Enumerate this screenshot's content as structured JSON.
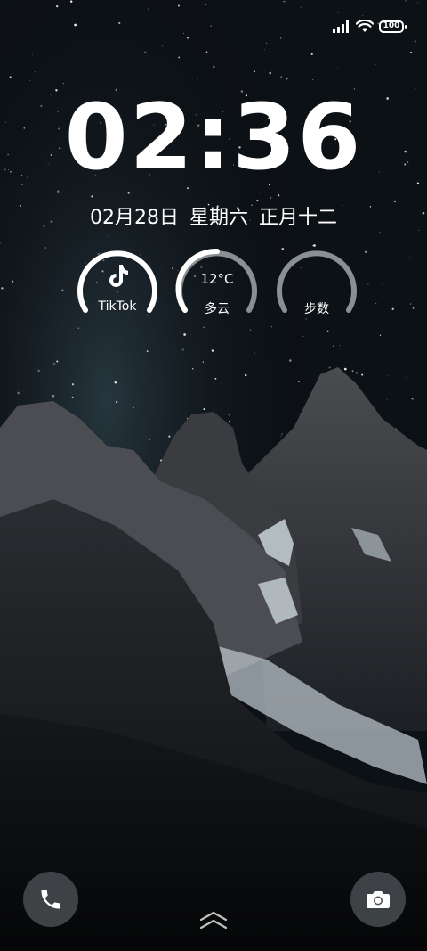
{
  "status_bar": {
    "battery_level": "100",
    "icons": [
      "signal-icon",
      "wifi-icon",
      "battery-icon"
    ]
  },
  "lock_screen": {
    "time": "02:36",
    "date": "02月28日",
    "weekday": "星期六",
    "lunar_date": "正月十二"
  },
  "widgets": {
    "tiktok": {
      "label": "TikTok",
      "icon": "tiktok-icon"
    },
    "weather": {
      "temperature": "12°C",
      "condition": "多云"
    },
    "steps": {
      "label": "步数"
    }
  },
  "shortcuts": {
    "phone_icon": "phone-icon",
    "camera_icon": "camera-icon",
    "swipe_icon": "swipe-up-icon"
  },
  "colors": {
    "text": "#ffffff",
    "ring_active": "#ffffff",
    "ring_inactive": "#8a8f94",
    "button_bg": "#50555a"
  }
}
